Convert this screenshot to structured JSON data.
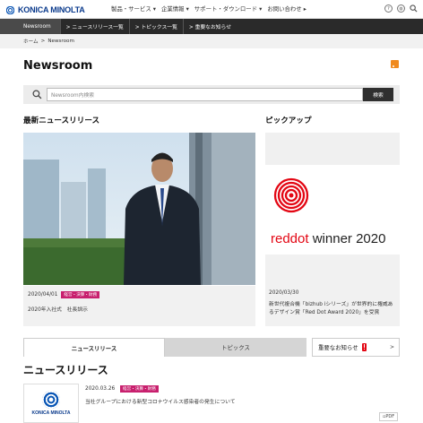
{
  "header": {
    "logo_text": "KONICA MINOLTA",
    "nav": [
      "製品・サービス ▾",
      "企業情報 ▾",
      "サポート・ダウンロード ▾",
      "お問い合わせ ▸"
    ],
    "icons": [
      "help-icon",
      "globe-icon",
      "search-icon"
    ]
  },
  "subnav": {
    "current": "Newsroom",
    "items": [
      "> ニュースリリース一覧",
      "> トピックス一覧",
      "> 重要なお知らせ"
    ]
  },
  "breadcrumb": {
    "home": "ホーム",
    "separator": ">",
    "current": "Newsroom"
  },
  "page_title": "Newsroom",
  "search": {
    "placeholder": "Newsroom内検索",
    "button": "検索"
  },
  "latest": {
    "heading": "最新ニュースリリース",
    "date": "2020/04/01",
    "badge": "経営・決算・財務",
    "title": "2020年入社式　社長訓示"
  },
  "pickup": {
    "heading": "ピックアップ",
    "award_text_red": "reddot",
    "award_text_dark": " winner 2020",
    "date": "2020/03/30",
    "title": "新世代複合機「bizhub iシリーズ」が世界的に権威あるデザイン賞「Red Dot Award 2020」を受賞"
  },
  "tabs": {
    "active": "ニュースリリース",
    "inactive": "トピックス",
    "extra": "重要なお知らせ",
    "extra_arrow": ">"
  },
  "newsreleases": {
    "heading": "ニュースリリース",
    "item": {
      "date": "2020.03.26",
      "badge": "経営・決算・財務",
      "title": "当社グループにおける新型コロナウイルス感染者の発生について",
      "thumb_logo": "KONICA MINOLTA",
      "pdf": "PDF"
    }
  },
  "colors": {
    "accent": "#c8206e",
    "dark": "#2a2a2a",
    "rss": "#f08a1e",
    "reddot": "#e30613"
  }
}
